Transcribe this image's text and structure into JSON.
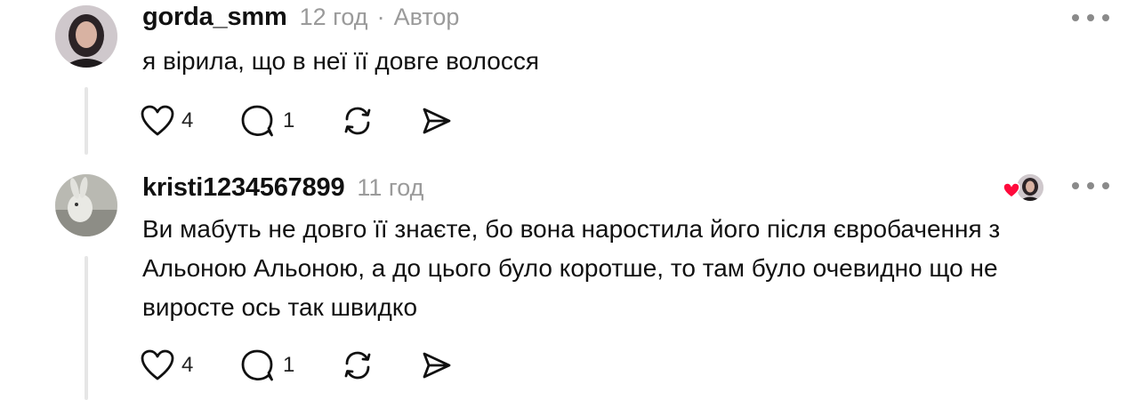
{
  "comments": [
    {
      "username": "gorda_smm",
      "time": "12 год",
      "separator": "·",
      "author_badge": "Автор",
      "text": "я вірила, що в неї її довге волосся",
      "likes": "4",
      "replies": "1",
      "icons": [
        "heart-icon",
        "comment-bubble-icon",
        "repost-icon",
        "share-send-icon",
        "more-dots-icon"
      ]
    },
    {
      "username": "kristi1234567899",
      "time": "11 год",
      "text": "Ви мабуть не довго її знаєте, бо вона наростила його після євробачення з Альоною Альоною, а до цього було коротше, то там було очевидно що не виросте ось так швидко",
      "text_lines": [
        "Ви мабуть не довго її знаєте, бо вона наростила його після євробачення з",
        "Альоною Альоною, а до цього було коротше, то там було очевидно що не",
        "виросте ось так швидко"
      ],
      "likes": "4",
      "replies": "1",
      "liked_by_author": true,
      "icons": [
        "heart-icon",
        "comment-bubble-icon",
        "repost-icon",
        "share-send-icon",
        "more-dots-icon"
      ]
    }
  ],
  "colors": {
    "meta_gray": "#9a9a9a",
    "thread_line": "#e6e6e6",
    "liked_heart": "#ff0a3c"
  }
}
